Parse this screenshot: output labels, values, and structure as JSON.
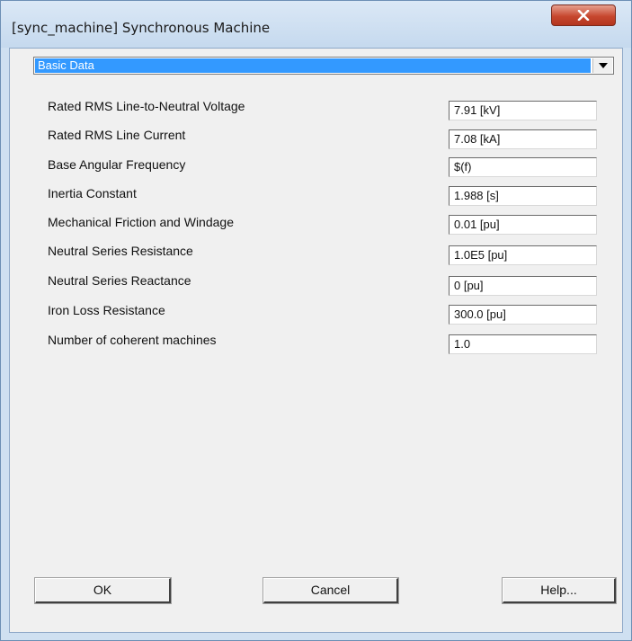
{
  "window": {
    "title": "[sync_machine] Synchronous Machine",
    "close_icon": "close-icon"
  },
  "dropdown": {
    "selected": "Basic Data",
    "arrow_icon": "chevron-down-icon"
  },
  "parameters": [
    {
      "label": "Rated RMS Line-to-Neutral Voltage",
      "value": "7.91 [kV]"
    },
    {
      "label": "Rated RMS Line Current",
      "value": "7.08 [kA]"
    },
    {
      "label": "Base Angular Frequency",
      "value": "$(f)"
    },
    {
      "label": "Inertia Constant",
      "value": "1.988 [s]"
    },
    {
      "label": "Mechanical Friction and Windage",
      "value": "0.01 [pu]"
    },
    {
      "label": "Neutral Series Resistance",
      "value": "1.0E5 [pu]"
    },
    {
      "label": "Neutral Series Reactance",
      "value": "0 [pu]"
    },
    {
      "label": "Iron Loss Resistance",
      "value": "300.0 [pu]"
    },
    {
      "label": "Number of coherent machines",
      "value": "1.0"
    }
  ],
  "buttons": {
    "ok": "OK",
    "cancel": "Cancel",
    "help": "Help..."
  },
  "colors": {
    "selection": "#3399ff",
    "close_button": "#c7472f",
    "frame": "#cfe0f1"
  }
}
